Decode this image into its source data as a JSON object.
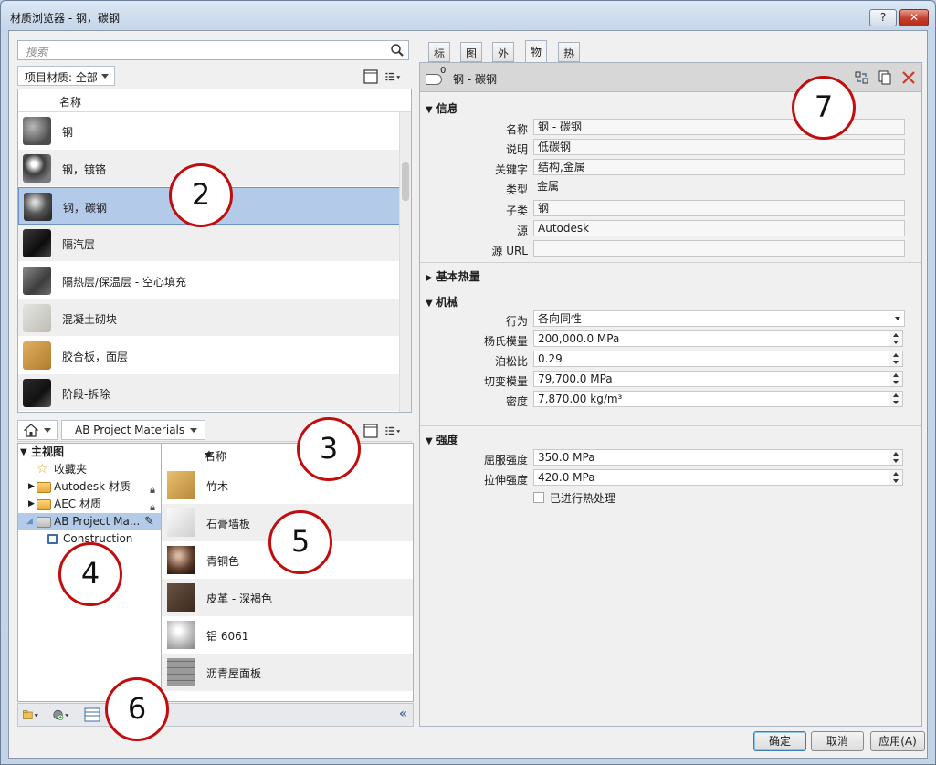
{
  "window": {
    "title": "材质浏览器 - 钢，碳钢",
    "help_label": "?",
    "close_label": "✕"
  },
  "search": {
    "placeholder": "搜索"
  },
  "filter": {
    "label": "项目材质: 全部"
  },
  "material_list": {
    "header": "名称",
    "items": [
      {
        "label": "钢",
        "thumb": "sphere-grey"
      },
      {
        "label": "钢，镀铬",
        "thumb": "chrome"
      },
      {
        "label": "钢，碳钢",
        "thumb": "sphere-dark",
        "selected": true
      },
      {
        "label": "隔汽层",
        "thumb": "cylinder-black"
      },
      {
        "label": "隔热层/保温层 - 空心填充",
        "thumb": "cylinder-grey"
      },
      {
        "label": "混凝土砌块",
        "thumb": "block-light"
      },
      {
        "label": "胶合板，面层",
        "thumb": "wood-box"
      },
      {
        "label": "阶段-拆除",
        "thumb": "cylinder-dark"
      }
    ]
  },
  "library": {
    "breadcrumb": "AB Project Materials",
    "tree": [
      {
        "label": "主视图",
        "bold": true
      },
      {
        "label": "收藏夹"
      },
      {
        "label": "Autodesk 材质",
        "locked": true
      },
      {
        "label": "AEC 材质",
        "locked": true
      },
      {
        "label": "AB Project Ma...",
        "selected": true
      },
      {
        "label": "Construction"
      }
    ],
    "header": "名称",
    "items": [
      {
        "label": "竹木",
        "thumb": "bamboo"
      },
      {
        "label": "石膏墙板",
        "thumb": "gypsum"
      },
      {
        "label": "青铜色",
        "thumb": "bronze"
      },
      {
        "label": "皮革 - 深褐色",
        "thumb": "leather"
      },
      {
        "label": "铝 6061",
        "thumb": "aluminum"
      },
      {
        "label": "沥青屋面板",
        "thumb": "shingle"
      }
    ]
  },
  "tabs": [
    {
      "label": "标识"
    },
    {
      "label": "图形"
    },
    {
      "label": "外观"
    },
    {
      "label": "物理",
      "active": true
    },
    {
      "label": "热度"
    }
  ],
  "asset": {
    "count": "0",
    "name": "钢 - 碳钢"
  },
  "sections": {
    "info": "信息",
    "thermal": "基本热量",
    "mechanical": "机械",
    "strength": "强度"
  },
  "info": {
    "name_label": "名称",
    "name_value": "钢 - 碳钢",
    "desc_label": "说明",
    "desc_value": "低碳钢",
    "keywords_label": "关键字",
    "keywords_value": "结构,金属",
    "type_label": "类型",
    "type_value": "金属",
    "subclass_label": "子类",
    "subclass_value": "钢",
    "source_label": "源",
    "source_value": "Autodesk",
    "url_label": "源 URL",
    "url_value": ""
  },
  "mechanical": {
    "behavior_label": "行为",
    "behavior_value": "各向同性",
    "youngs_label": "杨氏模量",
    "youngs_value": "200,000.0 MPa",
    "poisson_label": "泊松比",
    "poisson_value": "0.29",
    "shear_label": "切变模量",
    "shear_value": "79,700.0 MPa",
    "density_label": "密度",
    "density_value": "7,870.00 kg/m³"
  },
  "strength": {
    "yield_label": "屈服强度",
    "yield_value": "350.0 MPa",
    "tensile_label": "拉伸强度",
    "tensile_value": "420.0 MPa",
    "heat_label": "已进行热处理"
  },
  "buttons": {
    "ok": "确定",
    "cancel": "取消",
    "apply": "应用(A)"
  },
  "callouts": [
    "2",
    "3",
    "4",
    "5",
    "6",
    "7"
  ],
  "colors": {
    "selection": "#b3cbe8",
    "callout_ring": "#c00d0d",
    "close_red": "#c33e2a"
  }
}
